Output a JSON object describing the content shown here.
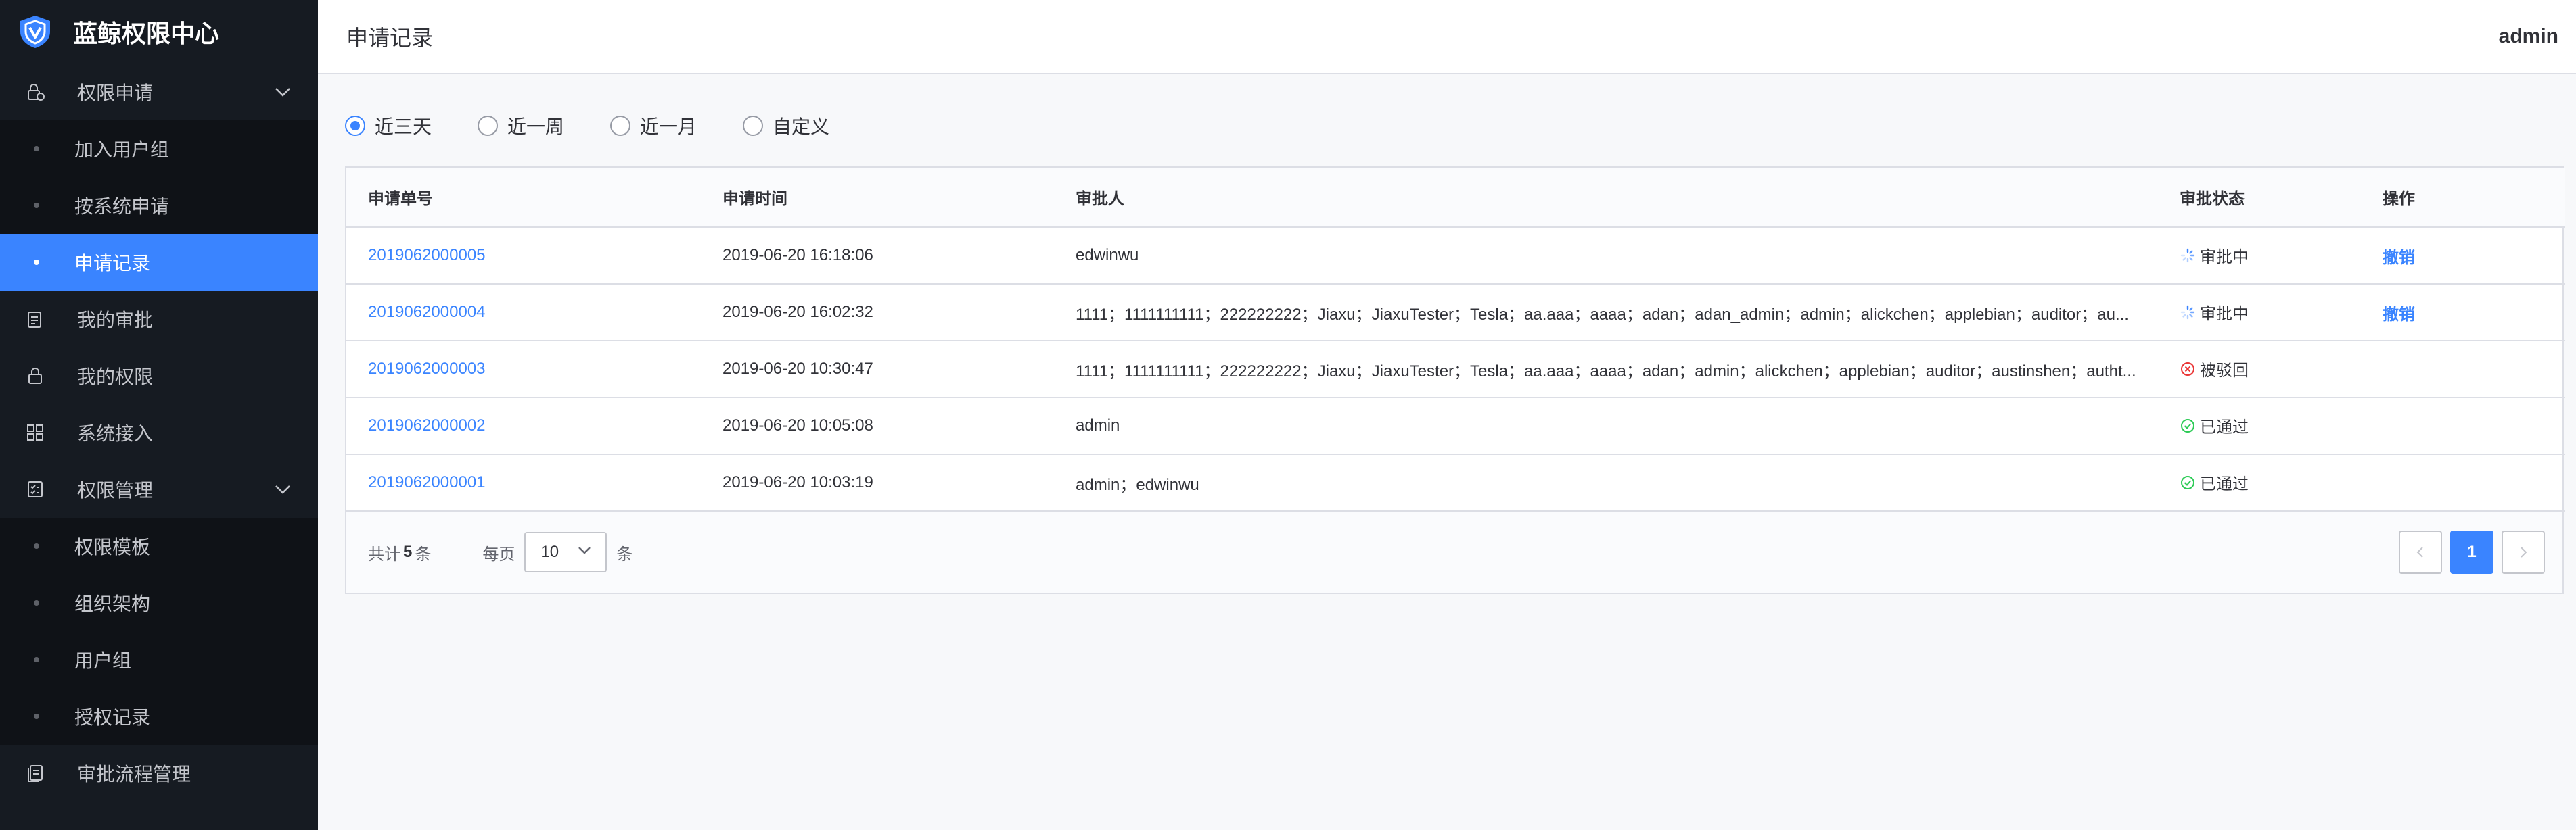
{
  "app": {
    "title": "蓝鲸权限中心",
    "brand_color": "#3a84ff"
  },
  "sidebar": {
    "groups": [
      {
        "label": "权限申请",
        "icon": "lock-apply-icon",
        "expanded": true,
        "children": [
          {
            "label": "加入用户组",
            "active": false
          },
          {
            "label": "按系统申请",
            "active": false
          },
          {
            "label": "申请记录",
            "active": true
          }
        ]
      },
      {
        "label": "我的审批",
        "icon": "clipboard-icon"
      },
      {
        "label": "我的权限",
        "icon": "lock-icon"
      },
      {
        "label": "系统接入",
        "icon": "grid-icon"
      },
      {
        "label": "权限管理",
        "icon": "checklist-icon",
        "expanded": true,
        "children": [
          {
            "label": "权限模板",
            "active": false
          },
          {
            "label": "组织架构",
            "active": false
          },
          {
            "label": "用户组",
            "active": false
          },
          {
            "label": "授权记录",
            "active": false
          }
        ]
      },
      {
        "label": "审批流程管理",
        "icon": "document-flow-icon"
      }
    ]
  },
  "header": {
    "page_title": "申请记录",
    "user": "admin"
  },
  "filter": {
    "options": [
      "近三天",
      "近一周",
      "近一月",
      "自定义"
    ],
    "selected": "近三天"
  },
  "table": {
    "columns": [
      "申请单号",
      "申请时间",
      "审批人",
      "审批状态",
      "操作"
    ],
    "rows": [
      {
        "id": "2019062000005",
        "time": "2019-06-20 16:18:06",
        "approvers": "edwinwu",
        "status": "审批中",
        "status_type": "pending",
        "action": "撤销"
      },
      {
        "id": "2019062000004",
        "time": "2019-06-20 16:02:32",
        "approvers": "1111；1111111111；222222222；Jiaxu；JiaxuTester；Tesla；aa.aaa；aaaa；adan；adan_admin；admin；alickchen；applebian；auditor；au...",
        "status": "审批中",
        "status_type": "pending",
        "action": "撤销"
      },
      {
        "id": "2019062000003",
        "time": "2019-06-20 10:30:47",
        "approvers": "1111；1111111111；222222222；Jiaxu；JiaxuTester；Tesla；aa.aaa；aaaa；adan；admin；alickchen；applebian；auditor；austinshen；autht...",
        "status": "被驳回",
        "status_type": "rejected",
        "action": ""
      },
      {
        "id": "2019062000002",
        "time": "2019-06-20 10:05:08",
        "approvers": "admin",
        "status": "已通过",
        "status_type": "approved",
        "action": ""
      },
      {
        "id": "2019062000001",
        "time": "2019-06-20 10:03:19",
        "approvers": "admin；edwinwu",
        "status": "已通过",
        "status_type": "approved",
        "action": ""
      }
    ],
    "status_colors": {
      "pending": "#3a84ff",
      "rejected": "#ea3636",
      "approved": "#2dcb56"
    }
  },
  "pagination": {
    "total_prefix": "共计",
    "total": "5",
    "total_suffix": "条",
    "per_page_prefix": "每页",
    "per_page": "10",
    "per_page_suffix": "条",
    "current_page": "1"
  }
}
